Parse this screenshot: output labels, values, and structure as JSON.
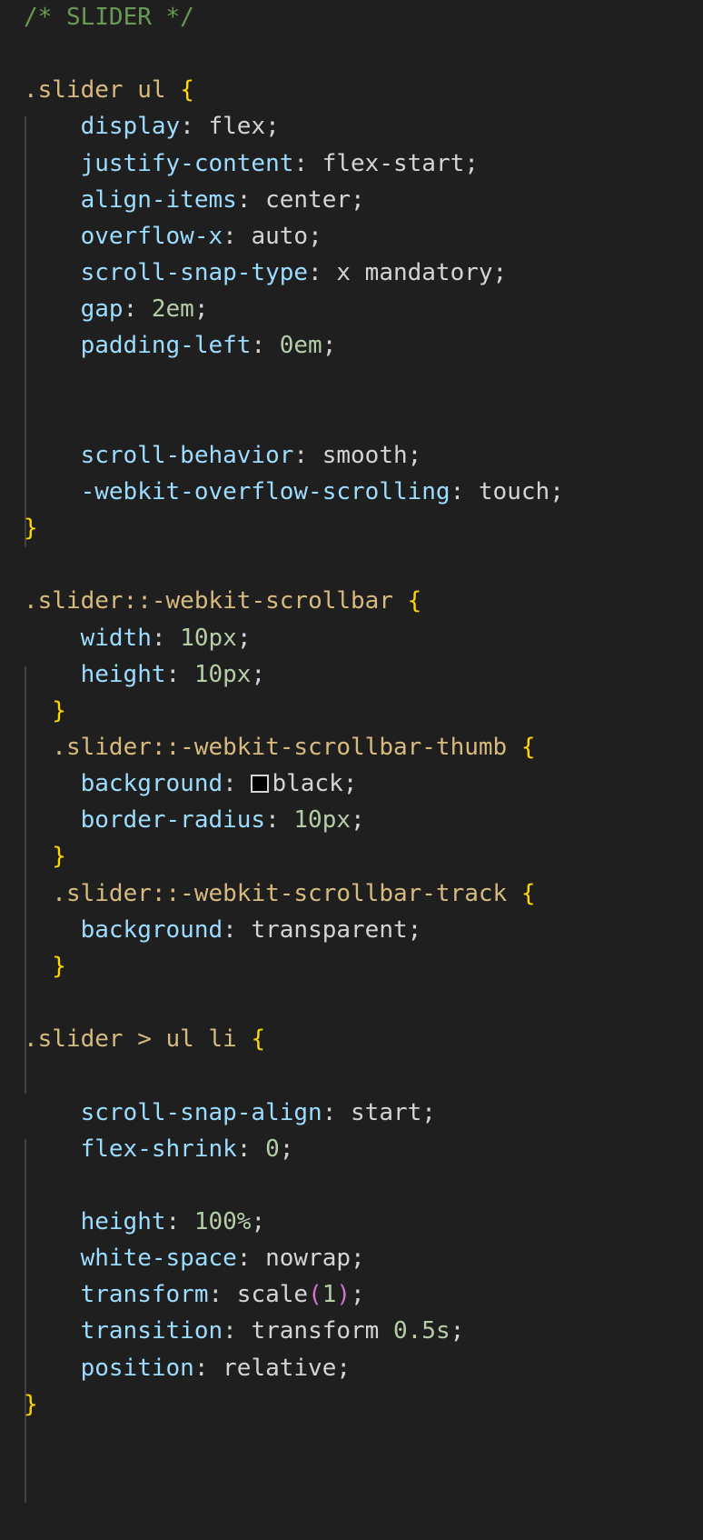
{
  "editor": {
    "language": "css",
    "theme_colors": {
      "background": "#1f1f1f",
      "comment": "#6a9955",
      "selector": "#d7ba7d",
      "brace": "#ffd700",
      "property": "#9cdcfe",
      "value": "#d4d4d4",
      "number": "#b5cea8",
      "paren": "#da70d6"
    },
    "lines": [
      {
        "indent": "",
        "tokens": [
          {
            "t": "comment",
            "v": "/* SLIDER */"
          }
        ]
      },
      {
        "indent": "",
        "tokens": []
      },
      {
        "indent": "",
        "tokens": [
          {
            "t": "selector",
            "v": ".slider ul "
          },
          {
            "t": "brace",
            "v": "{"
          }
        ]
      },
      {
        "indent": "    ",
        "tokens": [
          {
            "t": "prop",
            "v": "display"
          },
          {
            "t": "punct",
            "v": ": "
          },
          {
            "t": "val",
            "v": "flex"
          },
          {
            "t": "punct",
            "v": ";"
          }
        ]
      },
      {
        "indent": "    ",
        "tokens": [
          {
            "t": "prop",
            "v": "justify-content"
          },
          {
            "t": "punct",
            "v": ": "
          },
          {
            "t": "val",
            "v": "flex-start"
          },
          {
            "t": "punct",
            "v": ";"
          }
        ]
      },
      {
        "indent": "    ",
        "tokens": [
          {
            "t": "prop",
            "v": "align-items"
          },
          {
            "t": "punct",
            "v": ": "
          },
          {
            "t": "val",
            "v": "center"
          },
          {
            "t": "punct",
            "v": ";"
          }
        ]
      },
      {
        "indent": "    ",
        "tokens": [
          {
            "t": "prop",
            "v": "overflow-x"
          },
          {
            "t": "punct",
            "v": ": "
          },
          {
            "t": "val",
            "v": "auto"
          },
          {
            "t": "punct",
            "v": ";"
          }
        ]
      },
      {
        "indent": "    ",
        "tokens": [
          {
            "t": "prop",
            "v": "scroll-snap-type"
          },
          {
            "t": "punct",
            "v": ": "
          },
          {
            "t": "val",
            "v": "x mandatory"
          },
          {
            "t": "punct",
            "v": ";"
          }
        ]
      },
      {
        "indent": "    ",
        "tokens": [
          {
            "t": "prop",
            "v": "gap"
          },
          {
            "t": "punct",
            "v": ": "
          },
          {
            "t": "num",
            "v": "2em"
          },
          {
            "t": "punct",
            "v": ";"
          }
        ]
      },
      {
        "indent": "    ",
        "tokens": [
          {
            "t": "prop",
            "v": "padding-left"
          },
          {
            "t": "punct",
            "v": ": "
          },
          {
            "t": "num",
            "v": "0em"
          },
          {
            "t": "punct",
            "v": ";"
          }
        ]
      },
      {
        "indent": "",
        "tokens": []
      },
      {
        "indent": "",
        "tokens": []
      },
      {
        "indent": "    ",
        "tokens": [
          {
            "t": "prop",
            "v": "scroll-behavior"
          },
          {
            "t": "punct",
            "v": ": "
          },
          {
            "t": "val",
            "v": "smooth"
          },
          {
            "t": "punct",
            "v": ";"
          }
        ]
      },
      {
        "indent": "    ",
        "tokens": [
          {
            "t": "prop",
            "v": "-webkit-overflow-scrolling"
          },
          {
            "t": "punct",
            "v": ": "
          },
          {
            "t": "val",
            "v": "touch"
          },
          {
            "t": "punct",
            "v": ";"
          }
        ]
      },
      {
        "indent": "",
        "tokens": [
          {
            "t": "brace",
            "v": "}"
          }
        ]
      },
      {
        "indent": "",
        "tokens": []
      },
      {
        "indent": "",
        "tokens": [
          {
            "t": "selector",
            "v": ".slider::-webkit-scrollbar "
          },
          {
            "t": "brace",
            "v": "{"
          }
        ]
      },
      {
        "indent": "    ",
        "tokens": [
          {
            "t": "prop",
            "v": "width"
          },
          {
            "t": "punct",
            "v": ": "
          },
          {
            "t": "num",
            "v": "10px"
          },
          {
            "t": "punct",
            "v": ";"
          }
        ]
      },
      {
        "indent": "    ",
        "tokens": [
          {
            "t": "prop",
            "v": "height"
          },
          {
            "t": "punct",
            "v": ": "
          },
          {
            "t": "num",
            "v": "10px"
          },
          {
            "t": "punct",
            "v": ";"
          }
        ]
      },
      {
        "indent": "  ",
        "tokens": [
          {
            "t": "brace",
            "v": "}"
          }
        ]
      },
      {
        "indent": "  ",
        "tokens": [
          {
            "t": "selector",
            "v": ".slider::-webkit-scrollbar-thumb "
          },
          {
            "t": "brace",
            "v": "{"
          }
        ]
      },
      {
        "indent": "    ",
        "tokens": [
          {
            "t": "prop",
            "v": "background"
          },
          {
            "t": "punct",
            "v": ": "
          },
          {
            "t": "swatch",
            "v": ""
          },
          {
            "t": "val",
            "v": "black"
          },
          {
            "t": "punct",
            "v": ";"
          }
        ]
      },
      {
        "indent": "    ",
        "tokens": [
          {
            "t": "prop",
            "v": "border-radius"
          },
          {
            "t": "punct",
            "v": ": "
          },
          {
            "t": "num",
            "v": "10px"
          },
          {
            "t": "punct",
            "v": ";"
          }
        ]
      },
      {
        "indent": "  ",
        "tokens": [
          {
            "t": "brace",
            "v": "}"
          }
        ]
      },
      {
        "indent": "  ",
        "tokens": [
          {
            "t": "selector",
            "v": ".slider::-webkit-scrollbar-track "
          },
          {
            "t": "brace",
            "v": "{"
          }
        ]
      },
      {
        "indent": "    ",
        "tokens": [
          {
            "t": "prop",
            "v": "background"
          },
          {
            "t": "punct",
            "v": ": "
          },
          {
            "t": "val",
            "v": "transparent"
          },
          {
            "t": "punct",
            "v": ";"
          }
        ]
      },
      {
        "indent": "  ",
        "tokens": [
          {
            "t": "brace",
            "v": "}"
          }
        ]
      },
      {
        "indent": "",
        "tokens": []
      },
      {
        "indent": "",
        "tokens": [
          {
            "t": "selector",
            "v": ".slider > ul li "
          },
          {
            "t": "brace",
            "v": "{"
          }
        ]
      },
      {
        "indent": "",
        "tokens": []
      },
      {
        "indent": "    ",
        "tokens": [
          {
            "t": "prop",
            "v": "scroll-snap-align"
          },
          {
            "t": "punct",
            "v": ": "
          },
          {
            "t": "val",
            "v": "start"
          },
          {
            "t": "punct",
            "v": ";"
          }
        ]
      },
      {
        "indent": "    ",
        "tokens": [
          {
            "t": "prop",
            "v": "flex-shrink"
          },
          {
            "t": "punct",
            "v": ": "
          },
          {
            "t": "num",
            "v": "0"
          },
          {
            "t": "punct",
            "v": ";"
          }
        ]
      },
      {
        "indent": "",
        "tokens": []
      },
      {
        "indent": "    ",
        "tokens": [
          {
            "t": "prop",
            "v": "height"
          },
          {
            "t": "punct",
            "v": ": "
          },
          {
            "t": "num",
            "v": "100%"
          },
          {
            "t": "punct",
            "v": ";"
          }
        ]
      },
      {
        "indent": "    ",
        "tokens": [
          {
            "t": "prop",
            "v": "white-space"
          },
          {
            "t": "punct",
            "v": ": "
          },
          {
            "t": "val",
            "v": "nowrap"
          },
          {
            "t": "punct",
            "v": ";"
          }
        ]
      },
      {
        "indent": "    ",
        "tokens": [
          {
            "t": "prop",
            "v": "transform"
          },
          {
            "t": "punct",
            "v": ": "
          },
          {
            "t": "val",
            "v": "scale"
          },
          {
            "t": "paren",
            "v": "("
          },
          {
            "t": "num",
            "v": "1"
          },
          {
            "t": "paren",
            "v": ")"
          },
          {
            "t": "punct",
            "v": ";"
          }
        ]
      },
      {
        "indent": "    ",
        "tokens": [
          {
            "t": "prop",
            "v": "transition"
          },
          {
            "t": "punct",
            "v": ": "
          },
          {
            "t": "val",
            "v": "transform "
          },
          {
            "t": "num",
            "v": "0.5s"
          },
          {
            "t": "punct",
            "v": ";"
          }
        ]
      },
      {
        "indent": "    ",
        "tokens": [
          {
            "t": "prop",
            "v": "position"
          },
          {
            "t": "punct",
            "v": ": "
          },
          {
            "t": "val",
            "v": "relative"
          },
          {
            "t": "punct",
            "v": ";"
          }
        ]
      },
      {
        "indent": "",
        "tokens": [
          {
            "t": "brace",
            "v": "}"
          }
        ]
      }
    ]
  }
}
